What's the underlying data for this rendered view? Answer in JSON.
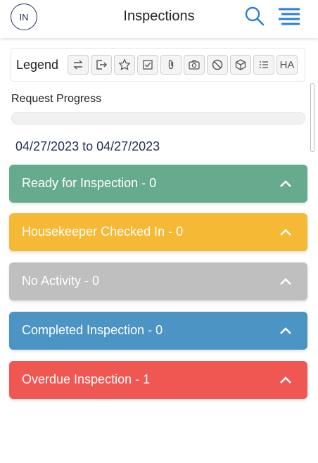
{
  "header": {
    "avatar_initials": "IN",
    "title": "Inspections",
    "search_icon": "search-icon",
    "menu_icon": "hamburger-menu-icon",
    "accent_color": "#2b7fd6"
  },
  "legend": {
    "label": "Legend",
    "icons": [
      {
        "name": "swap-icon"
      },
      {
        "name": "exit-icon"
      },
      {
        "name": "star-icon"
      },
      {
        "name": "checkbox-icon"
      },
      {
        "name": "paperclip-icon"
      },
      {
        "name": "camera-icon"
      },
      {
        "name": "block-icon"
      },
      {
        "name": "box-icon"
      },
      {
        "name": "list-icon"
      },
      {
        "name": "ha-text-icon",
        "text": "HA"
      }
    ]
  },
  "progress": {
    "label": "Request Progress",
    "fraction": 0
  },
  "date_range": "04/27/2023 to 04/27/2023",
  "sections": [
    {
      "label": "Ready for Inspection - 0",
      "color": "#67ab8f"
    },
    {
      "label": "Housekeeper Checked In - 0",
      "color": "#f5b935"
    },
    {
      "label": "No Activity - 0",
      "color": "#bfbfbf"
    },
    {
      "label": "Completed Inspection - 0",
      "color": "#4b94c3"
    },
    {
      "label": "Overdue Inspection - 1",
      "color": "#f05752"
    }
  ]
}
